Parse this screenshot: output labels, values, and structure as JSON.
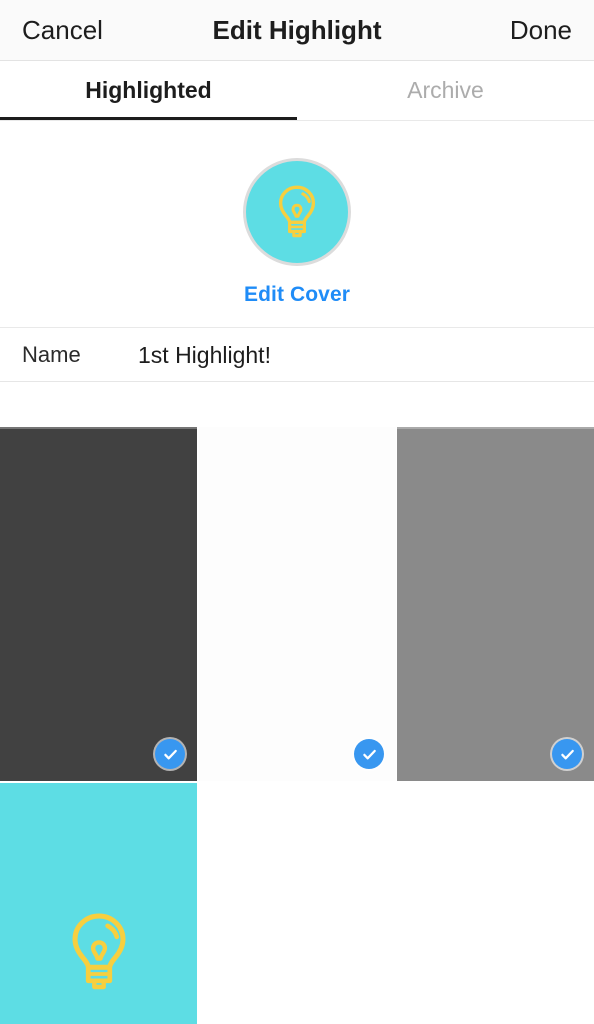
{
  "navbar": {
    "cancel_label": "Cancel",
    "title": "Edit Highlight",
    "done_label": "Done"
  },
  "tabs": [
    {
      "label": "Highlighted",
      "active": true
    },
    {
      "label": "Archive",
      "active": false
    }
  ],
  "cover": {
    "edit_cover_label": "Edit Cover",
    "circle_fill": "#5ddde4",
    "ring_color": "#dcdcdc",
    "icon": "lightbulb-icon",
    "icon_color": "#f7cf3f"
  },
  "name_row": {
    "label": "Name",
    "value": "1st Highlight!",
    "placeholder": "Name"
  },
  "grid": {
    "tiles": [
      {
        "name": "story-thumb-1",
        "color": "#414141",
        "selected": true
      },
      {
        "name": "story-thumb-2",
        "color": "#fdfdfd",
        "selected": true
      },
      {
        "name": "story-thumb-3",
        "color": "#8a8a8a",
        "selected": true
      },
      {
        "name": "story-thumb-4",
        "color": "#5ddde4",
        "selected": false,
        "icon": "lightbulb-icon"
      }
    ],
    "check_color": "#3897f0",
    "check_icon": "check-icon"
  },
  "theme": {
    "accent_blue": "#1f8cf7",
    "navbar_bg": "#fafafa",
    "text_primary": "#1d1d1d",
    "text_muted": "#acacac",
    "cyan": "#5ddde4",
    "yellow": "#f7cf3f"
  }
}
